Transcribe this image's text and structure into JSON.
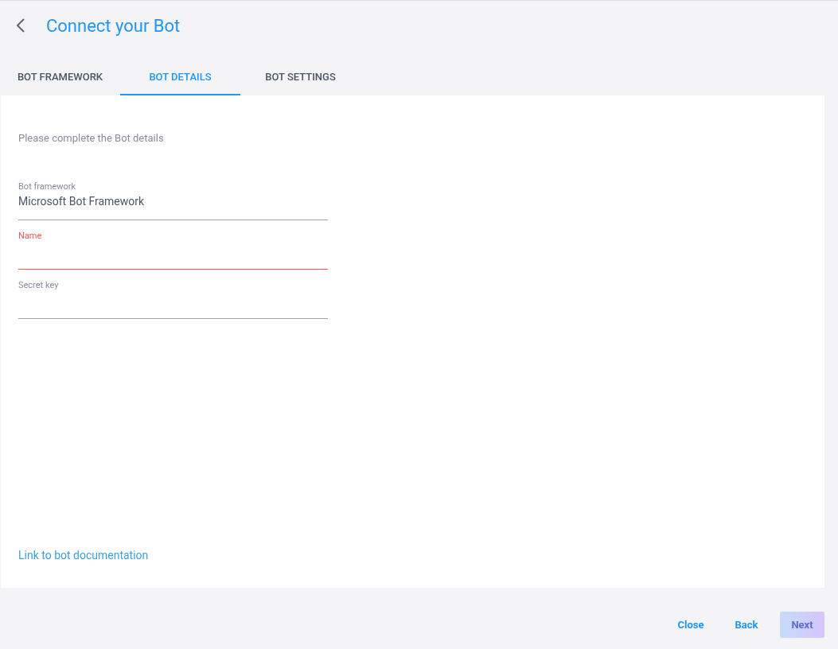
{
  "header": {
    "title": "Connect your Bot"
  },
  "tabs": [
    {
      "label": "BOT FRAMEWORK",
      "selected": false
    },
    {
      "label": "BOT DETAILS",
      "selected": true
    },
    {
      "label": "BOT SETTINGS",
      "selected": false
    }
  ],
  "intro": "Please complete the Bot details",
  "fields": [
    {
      "label": "Bot framework",
      "value": "Microsoft Bot Framework",
      "error": false
    },
    {
      "label": "Name",
      "error": true
    },
    {
      "label": "Secret key",
      "error": false
    }
  ],
  "link": "Link to bot documentation",
  "buttons": [
    {
      "label": "Close",
      "disabled": false,
      "primary": false
    },
    {
      "label": "Back",
      "disabled": false,
      "primary": false
    },
    {
      "label": "Next",
      "disabled": true,
      "primary": true
    }
  ]
}
